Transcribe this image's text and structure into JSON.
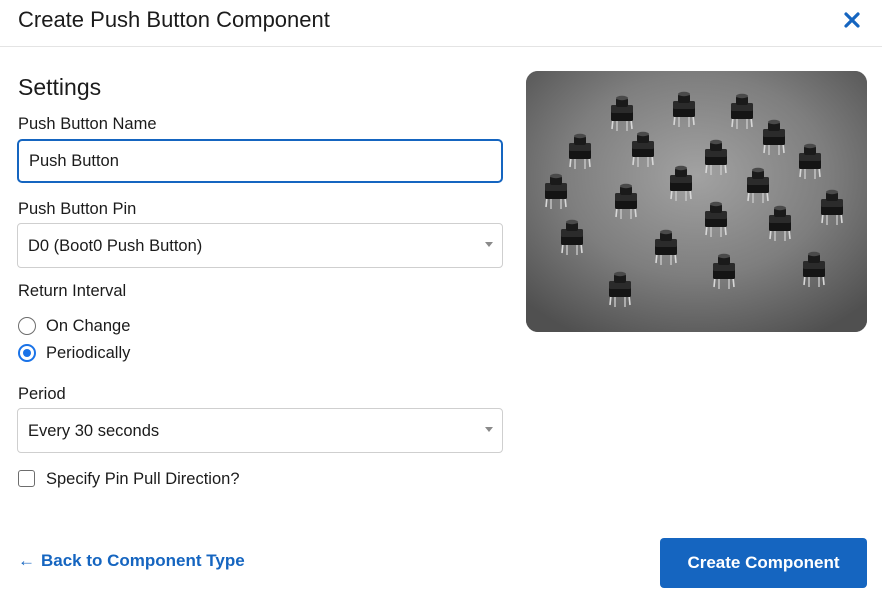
{
  "modal": {
    "title": "Create Push Button Component",
    "close_icon": "close-icon"
  },
  "settings": {
    "heading": "Settings",
    "name_label": "Push Button Name",
    "name_value": "Push Button",
    "pin_label": "Push Button Pin",
    "pin_value": "D0 (Boot0 Push Button)",
    "return_interval_label": "Return Interval",
    "return_options": [
      {
        "label": "On Change",
        "checked": false
      },
      {
        "label": "Periodically",
        "checked": true
      }
    ],
    "period_label": "Period",
    "period_value": "Every 30 seconds",
    "pull_direction_label": "Specify Pin Pull Direction?",
    "pull_direction_checked": false
  },
  "footer": {
    "back_label": "Back to Component Type",
    "back_icon": "arrow-left-icon",
    "create_label": "Create Component"
  },
  "colors": {
    "accent": "#1565c0",
    "radio_accent": "#1a73e8"
  }
}
